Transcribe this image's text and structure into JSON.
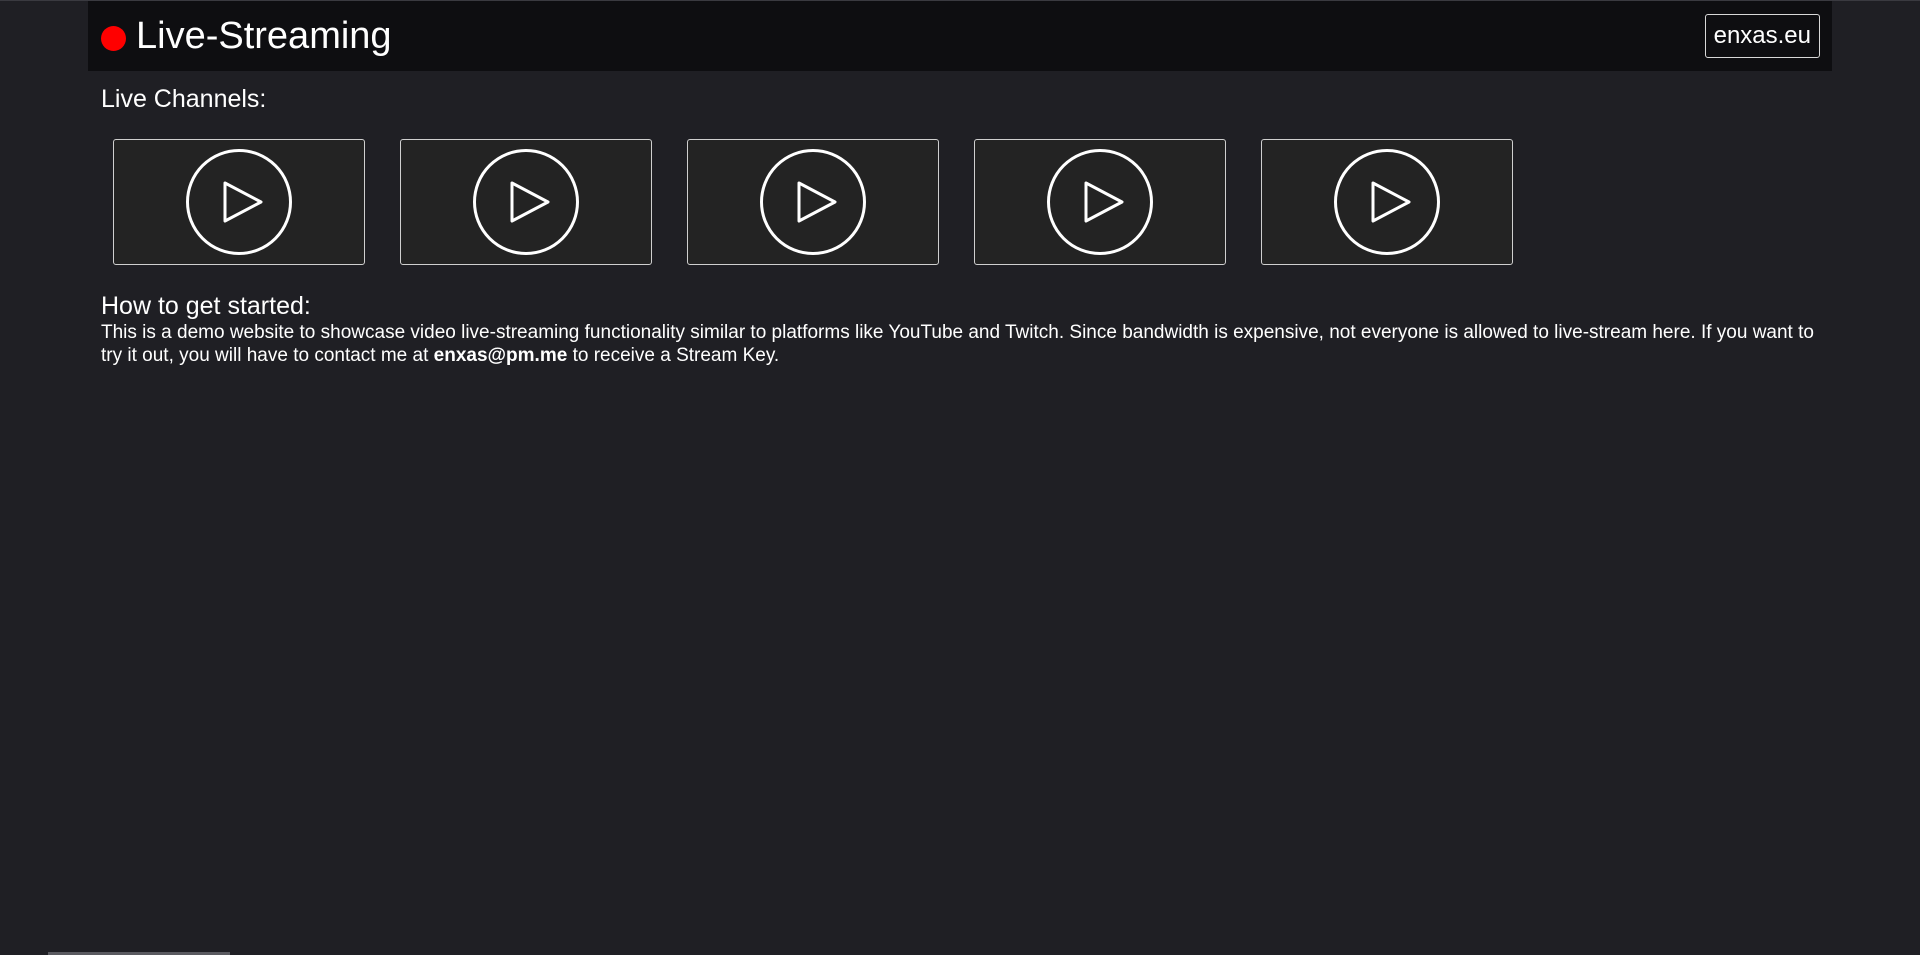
{
  "header": {
    "title": "Live-Streaming",
    "site_link": "enxas.eu",
    "live_color": "#ff0000"
  },
  "channels": {
    "heading": "Live Channels:",
    "items": [
      {
        "icon": "play-circle-icon"
      },
      {
        "icon": "play-circle-icon"
      },
      {
        "icon": "play-circle-icon"
      },
      {
        "icon": "play-circle-icon"
      },
      {
        "icon": "play-circle-icon"
      }
    ]
  },
  "howto": {
    "heading": "How to get started:",
    "text_before": "This is a demo website to showcase video live-streaming functionality similar to platforms like YouTube and Twitch. Since bandwidth is expensive, not everyone is allowed to live-stream here. If you want to try it out, you will have to contact me at ",
    "email": "enxas@pm.me",
    "text_after": " to receive a Stream Key."
  }
}
